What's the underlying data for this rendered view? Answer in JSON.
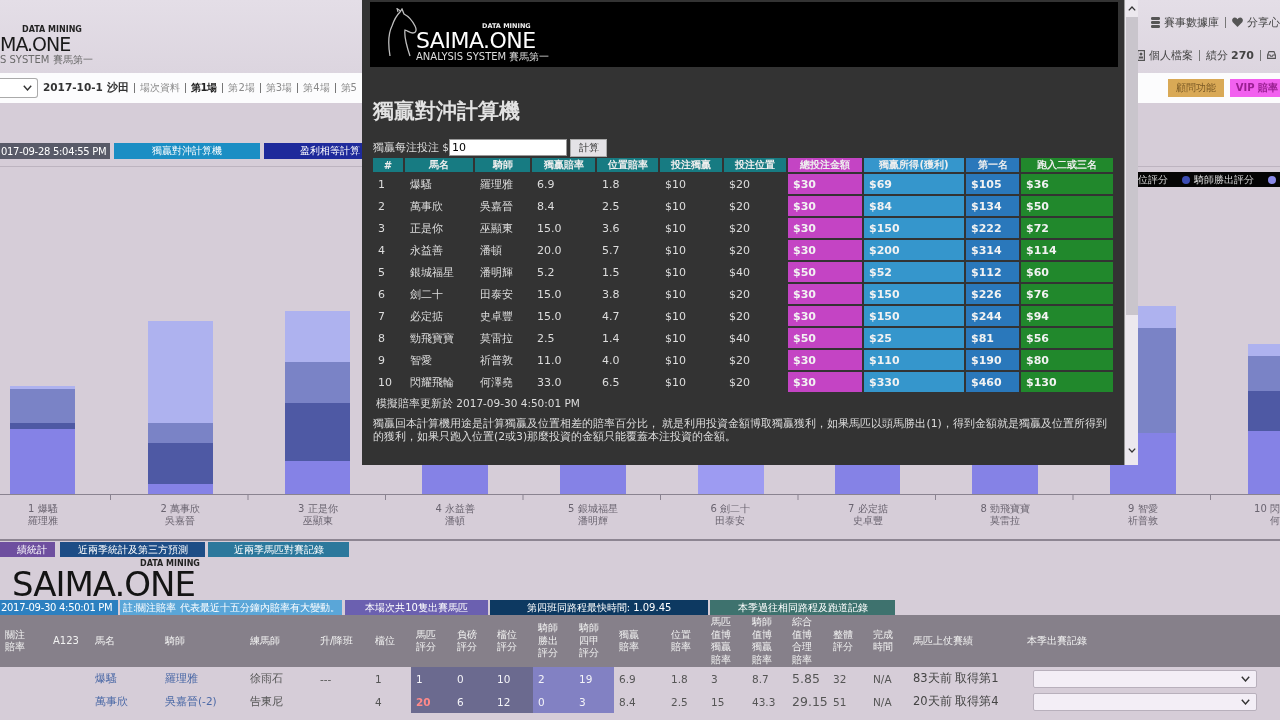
{
  "header": {
    "logo": {
      "tagline": "DATA MINING",
      "wordmark": "MA.ONE",
      "subtitle": "S SYSTEM 賽馬第一"
    },
    "links": [
      "賽事數據庫",
      "分享心"
    ],
    "account": [
      "個人檔案",
      "績分 **270**"
    ]
  },
  "nav": {
    "meeting": "2017-10-1 沙田",
    "items": [
      {
        "label": "場次資料",
        "selected": false
      },
      {
        "label": "第1場",
        "selected": true
      },
      {
        "label": "第2場",
        "selected": false
      },
      {
        "label": "第3場",
        "selected": false
      },
      {
        "label": "第4場",
        "selected": false
      },
      {
        "label": "第5",
        "selected": false
      }
    ],
    "buttons": [
      {
        "label": "顧問功能",
        "color": "#d9a956"
      },
      {
        "label": "VIP 賠率",
        "color": "#f261ef"
      }
    ]
  },
  "toolbar": {
    "updated": "017-09-28 5:04:55 PM",
    "buttons": [
      {
        "label": "獨贏對沖計算機",
        "color": "#1b8ec4"
      },
      {
        "label": "盈利相等計算",
        "color": "#1e2a9b"
      }
    ]
  },
  "chart": {
    "legend": [
      {
        "label": "位評分"
      },
      {
        "label": "騎師勝出評分",
        "color": "#3c4db4"
      },
      {
        "color": "#8a8ae8"
      }
    ],
    "x_labels": [
      {
        "horse": "1 爆騷",
        "jockey": "羅理雅"
      },
      {
        "horse": "2 萬事欣",
        "jockey": "吳嘉晉"
      },
      {
        "horse": "3 正是你",
        "jockey": "巫顯東"
      },
      {
        "horse": "4 永益善",
        "jockey": "潘頓"
      },
      {
        "horse": "5 銀城福星",
        "jockey": "潘明輝"
      },
      {
        "horse": "6 劍二十",
        "jockey": "田泰安"
      },
      {
        "horse": "7 必定掂",
        "jockey": "史卓豐"
      },
      {
        "horse": "8 勁飛寶寶",
        "jockey": "莫雷拉"
      },
      {
        "horse": "9 智愛",
        "jockey": "祈普敦"
      },
      {
        "horse": "10 閃",
        "jockey": "何"
      }
    ]
  },
  "section_tabs": [
    {
      "label": "績統計",
      "color": "#6e4f9f"
    },
    {
      "label": "近兩季統計及第三方預測",
      "color": "#1d4d86"
    },
    {
      "label": "近兩季馬匹對賽記錄",
      "color": "#2c789c"
    }
  ],
  "footer_logo": {
    "tagline": "DATA MINING",
    "wordmark": "SAIMA.ONE"
  },
  "info_bar": [
    {
      "label": "2017-09-30 4:50:01 PM",
      "color": "#2c80c0"
    },
    {
      "label": "註:關注賠率 代表最近十五分鐘內賠率有大變動。",
      "color": "#5aa6d8"
    },
    {
      "label": "本場次共10隻出賽馬匹",
      "color": "#6b60b0"
    },
    {
      "label": "第四班同路程最快時間: 1.09.45",
      "color": "#0d3961"
    },
    {
      "label": "本季過往相同路程及跑道記錄",
      "color": "#3e726e"
    }
  ],
  "race_table": {
    "columns": [
      "關注賠率",
      "A123",
      "馬名",
      "騎師",
      "練馬師",
      "升/降班",
      "檔位",
      "馬匹評分",
      "負磅評分",
      "檔位評分",
      "騎師勝出評分",
      "騎師四甲評分",
      "獨贏賠率",
      "位置賠率",
      "馬匹值博獨贏賠率",
      "騎師值博獨贏賠率",
      "綜合值博合理賠率",
      "整體評分",
      "完成時間",
      "馬匹上仗賽績",
      "本季出賽記錄"
    ],
    "rows": [
      {
        "horse": "爆騷",
        "jockey": "羅理雅",
        "trainer": "徐雨石",
        "class_change": "---",
        "draw": "1",
        "horse_score": "1",
        "horse_score_alert": false,
        "weight_score": "0",
        "draw_score": "10",
        "jockey_win_score": "2",
        "jockey_place_score": "19",
        "win_odds": "6.9",
        "place_odds": "1.8",
        "horse_value_odds": "3",
        "jockey_value_odds": "8.7",
        "fair_odds": "5.85",
        "overall_score": "32",
        "finish_time": "N/A",
        "last_run": "83天前 取得第1"
      },
      {
        "horse": "萬事欣",
        "jockey": "吳嘉晉(-2)",
        "trainer": "告東尼",
        "draw": "4",
        "horse_score": "20",
        "horse_score_alert": true,
        "weight_score": "6",
        "draw_score": "12",
        "jockey_win_score": "0",
        "jockey_place_score": "3",
        "win_odds": "8.4",
        "place_odds": "2.5",
        "horse_value_odds": "15",
        "jockey_value_odds": "43.3",
        "fair_odds": "29.15",
        "overall_score": "51",
        "finish_time": "N/A",
        "last_run": "20天前 取得第4"
      }
    ]
  },
  "calculator": {
    "logo": {
      "tagline": "DATA MINING",
      "wordmark": "SAIMA.ONE",
      "subtitle": "ANALYSIS SYSTEM 賽馬第一"
    },
    "title": "獨贏對沖計算機",
    "stake_label": "獨贏每注投注 $",
    "stake_value": "10",
    "button": "計算",
    "columns": [
      {
        "label": "#",
        "color": "#177b82",
        "filled": false
      },
      {
        "label": "馬名",
        "color": "#177b82",
        "filled": false
      },
      {
        "label": "騎師",
        "color": "#177b82",
        "filled": false
      },
      {
        "label": "獨贏賠率",
        "color": "#177b82",
        "filled": false
      },
      {
        "label": "位置賠率",
        "color": "#177b82",
        "filled": false
      },
      {
        "label": "投注獨贏",
        "color": "#177b82",
        "filled": false
      },
      {
        "label": "投注位置",
        "color": "#177b82",
        "filled": false
      },
      {
        "label": "總投注金額",
        "color": "#c444c4",
        "filled": true
      },
      {
        "label": "獨贏所得(獲利)",
        "color": "#3596cc",
        "filled": true
      },
      {
        "label": "第一名",
        "color": "#2a78bb",
        "filled": true
      },
      {
        "label": "跑入二或三名",
        "color": "#21882c",
        "filled": true
      }
    ],
    "rows": [
      {
        "no": "1",
        "horse": "爆騷",
        "jockey": "羅理雅",
        "win_odds": "6.9",
        "place_odds": "1.8",
        "win_bet": "$10",
        "place_bet": "$20",
        "total": "$30",
        "win_return": "$69",
        "first": "$105",
        "second_third": "$36"
      },
      {
        "no": "2",
        "horse": "萬事欣",
        "jockey": "吳嘉晉",
        "win_odds": "8.4",
        "place_odds": "2.5",
        "win_bet": "$10",
        "place_bet": "$20",
        "total": "$30",
        "win_return": "$84",
        "first": "$134",
        "second_third": "$50"
      },
      {
        "no": "3",
        "horse": "正是你",
        "jockey": "巫顯東",
        "win_odds": "15.0",
        "place_odds": "3.6",
        "win_bet": "$10",
        "place_bet": "$20",
        "total": "$30",
        "win_return": "$150",
        "first": "$222",
        "second_third": "$72"
      },
      {
        "no": "4",
        "horse": "永益善",
        "jockey": "潘頓",
        "win_odds": "20.0",
        "place_odds": "5.7",
        "win_bet": "$10",
        "place_bet": "$20",
        "total": "$30",
        "win_return": "$200",
        "first": "$314",
        "second_third": "$114"
      },
      {
        "no": "5",
        "horse": "銀城福星",
        "jockey": "潘明輝",
        "win_odds": "5.2",
        "place_odds": "1.5",
        "win_bet": "$10",
        "place_bet": "$40",
        "total": "$50",
        "win_return": "$52",
        "first": "$112",
        "second_third": "$60"
      },
      {
        "no": "6",
        "horse": "劍二十",
        "jockey": "田泰安",
        "win_odds": "15.0",
        "place_odds": "3.8",
        "win_bet": "$10",
        "place_bet": "$20",
        "total": "$30",
        "win_return": "$150",
        "first": "$226",
        "second_third": "$76"
      },
      {
        "no": "7",
        "horse": "必定掂",
        "jockey": "史卓豐",
        "win_odds": "15.0",
        "place_odds": "4.7",
        "win_bet": "$10",
        "place_bet": "$20",
        "total": "$30",
        "win_return": "$150",
        "first": "$244",
        "second_third": "$94"
      },
      {
        "no": "8",
        "horse": "勁飛寶寶",
        "jockey": "莫雷拉",
        "win_odds": "2.5",
        "place_odds": "1.4",
        "win_bet": "$10",
        "place_bet": "$40",
        "total": "$50",
        "win_return": "$25",
        "first": "$81",
        "second_third": "$56"
      },
      {
        "no": "9",
        "horse": "智愛",
        "jockey": "祈普敦",
        "win_odds": "11.0",
        "place_odds": "4.0",
        "win_bet": "$10",
        "place_bet": "$20",
        "total": "$30",
        "win_return": "$110",
        "first": "$190",
        "second_third": "$80"
      },
      {
        "no": "10",
        "horse": "閃耀飛輪",
        "jockey": "何澤堯",
        "win_odds": "33.0",
        "place_odds": "6.5",
        "win_bet": "$10",
        "place_bet": "$20",
        "total": "$30",
        "win_return": "$330",
        "first": "$460",
        "second_third": "$130"
      }
    ],
    "updated": "模擬賠率更新於 2017-09-30 4:50:01 PM",
    "description": "獨贏回本計算機用途是計算獨贏及位置相差的賠率百分比， 就是利用投資金額博取獨贏獲利，如果馬匹以頭馬勝出(1)，得到金額就是獨贏及位置所得到的獲利，如果只跑入位置(2或3)那麼投資的金額只能覆蓋本注投資的金額。"
  }
}
